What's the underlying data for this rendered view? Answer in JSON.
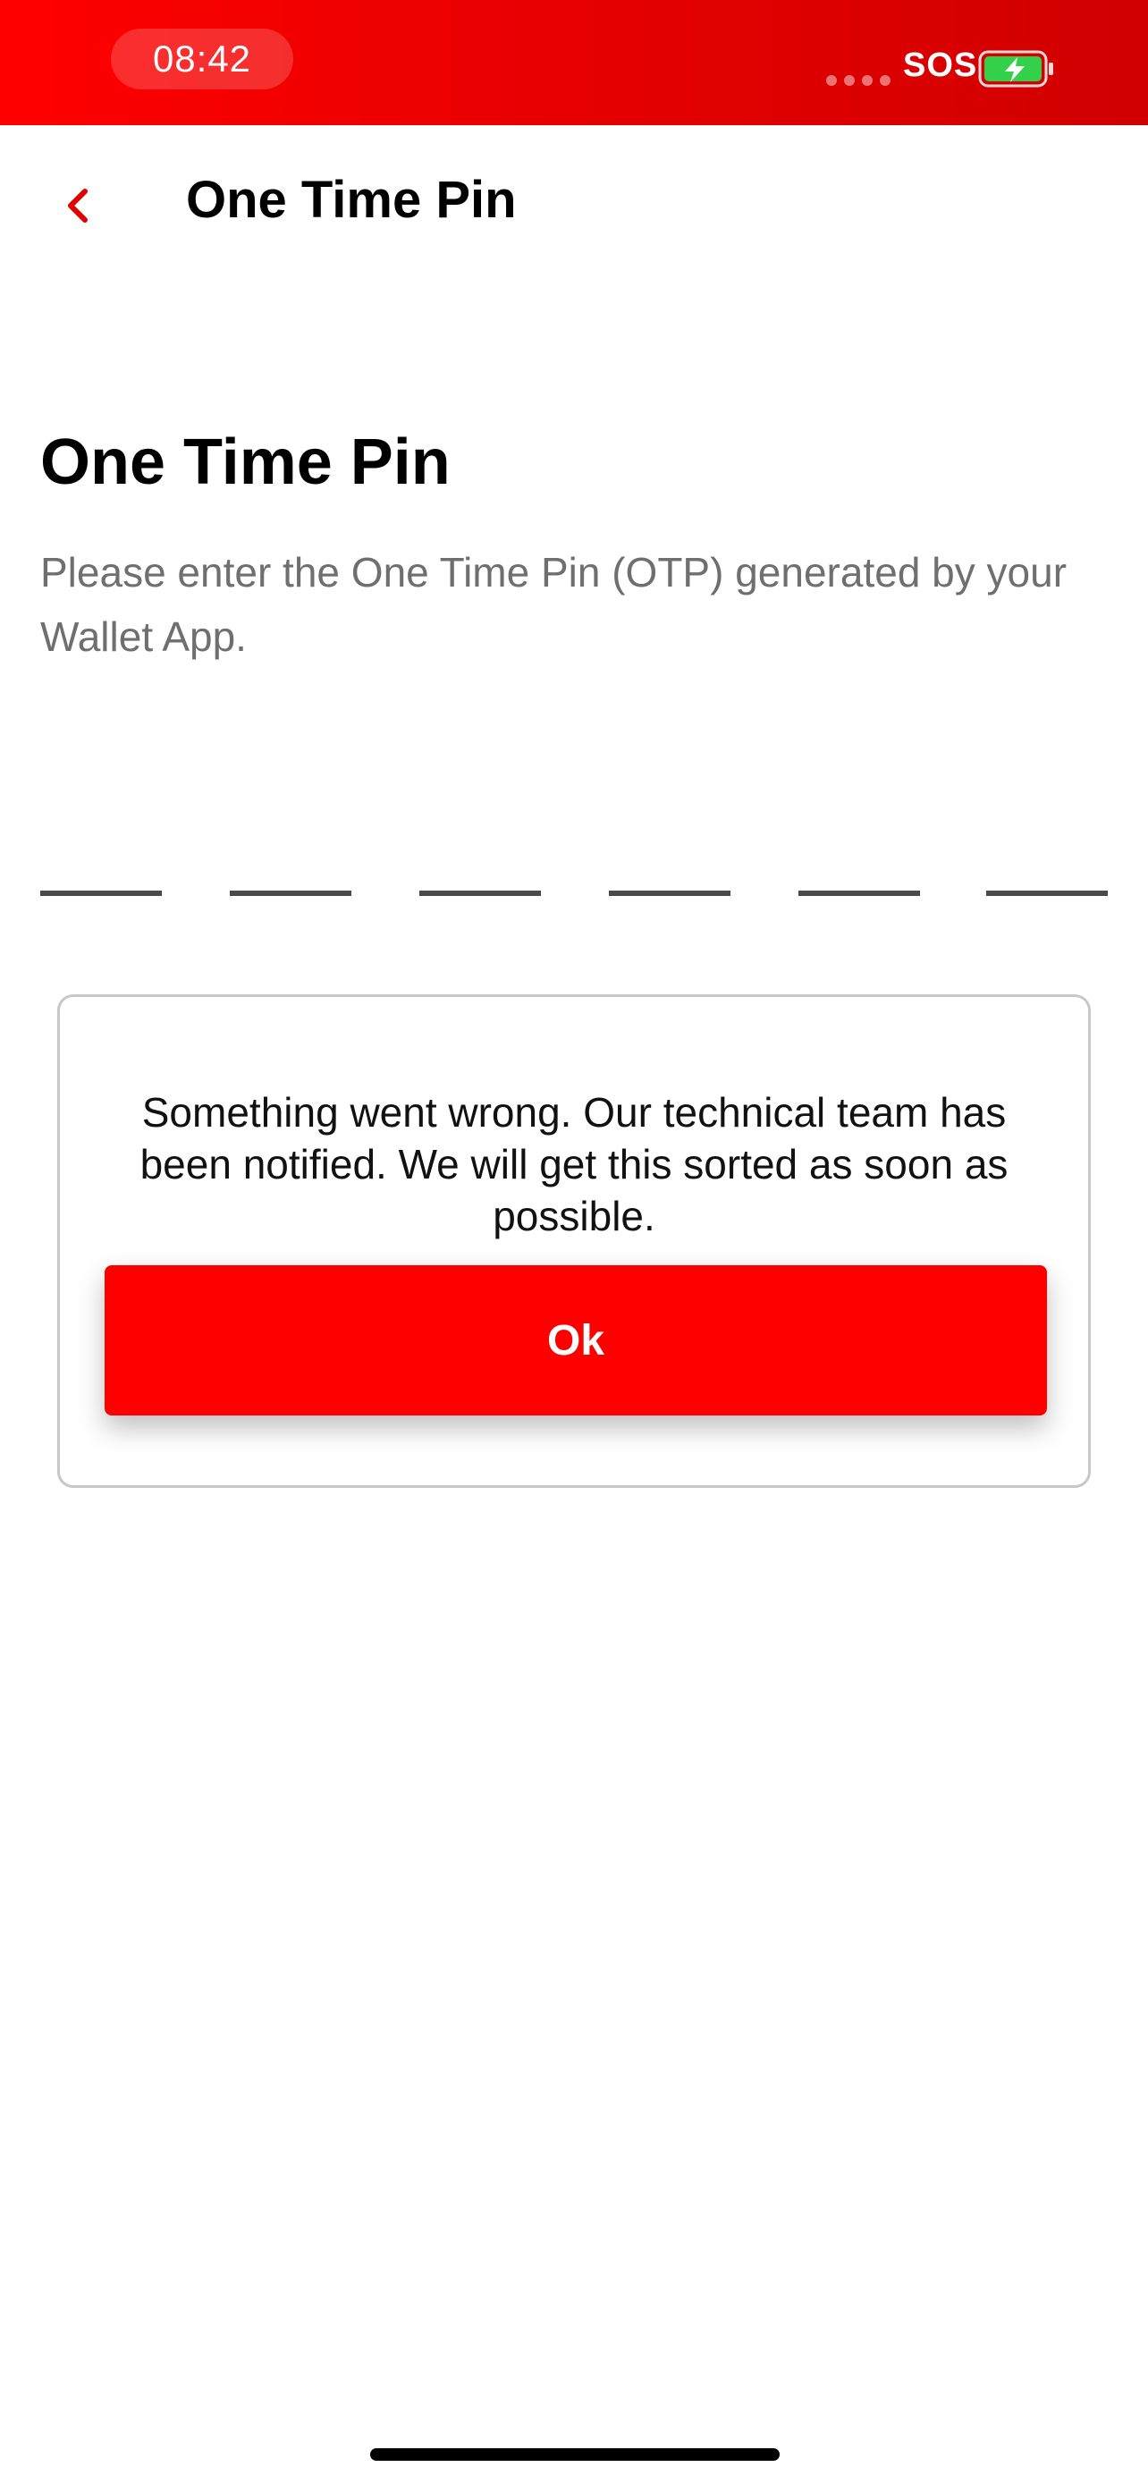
{
  "status_bar": {
    "time": "08:42",
    "carrier_text": "SOS",
    "battery_icon": "battery-charging-icon",
    "colors": {
      "background": "#ff0000",
      "battery_fill": "#33d04a"
    }
  },
  "nav": {
    "back_icon": "chevron-left-icon",
    "title": "One Time Pin"
  },
  "main": {
    "heading": "One Time Pin",
    "description": "Please enter the One Time Pin (OTP) generated by your Wallet App.",
    "otp_slot_count": 6
  },
  "dialog": {
    "message": "Something went wrong. Our technical team has been notified. We will get this sorted as soon as possible.",
    "ok_label": "Ok"
  },
  "theme": {
    "accent": "#ff0000",
    "text_secondary": "#6f6f6f"
  }
}
